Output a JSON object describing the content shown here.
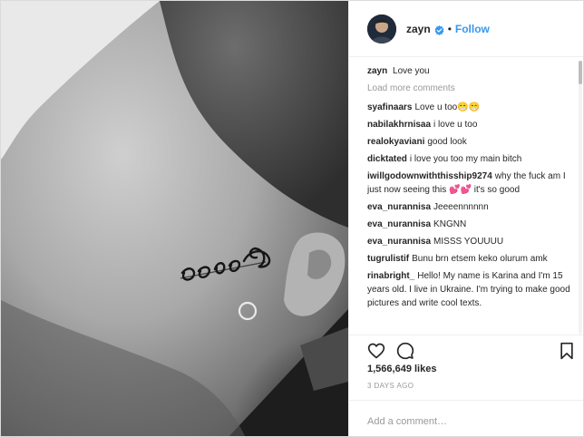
{
  "post": {
    "username": "zayn",
    "follow_label": "Follow",
    "separator": "•",
    "verified": true
  },
  "caption": {
    "user": "zayn",
    "text": "Love you"
  },
  "load_more_label": "Load more comments",
  "comments": [
    {
      "user": "syafinaars",
      "text": "Love u too😁😁"
    },
    {
      "user": "nabilakhrnisaa",
      "text": "i love u too"
    },
    {
      "user": "realokyaviani",
      "text": "good look"
    },
    {
      "user": "dicktated",
      "text": "i love you too my main bitch"
    },
    {
      "user": "iwillgodownwiththisship9274",
      "text": "why the fuck am I just now seeing this 💕💕 it's so good"
    },
    {
      "user": "eva_nurannisa",
      "text": "Jeeeennnnnn"
    },
    {
      "user": "eva_nurannisa",
      "text": "KNGNN"
    },
    {
      "user": "eva_nurannisa",
      "text": "MISSS YOUUUU"
    },
    {
      "user": "tugrulistif",
      "text": "Bunu brn etsem keko olurum amk"
    },
    {
      "user": "rinabright_",
      "text": "Hello! My name is Karina and I'm 15 years old. I live in Ukraine. I'm trying to make good pictures and write cool texts."
    }
  ],
  "likes": "1,566,649 likes",
  "timestamp": "3 DAYS AGO",
  "add_comment": {
    "placeholder": "Add a comment…"
  },
  "icons": {
    "like": "heart-icon",
    "comment": "speech-bubble-icon",
    "save": "bookmark-icon",
    "verified": "verified-badge-icon"
  },
  "colors": {
    "link_blue": "#3897f0",
    "verified_blue": "#3897f0",
    "muted_text": "#999999"
  },
  "photo": {
    "tattoo_text": "Love"
  }
}
